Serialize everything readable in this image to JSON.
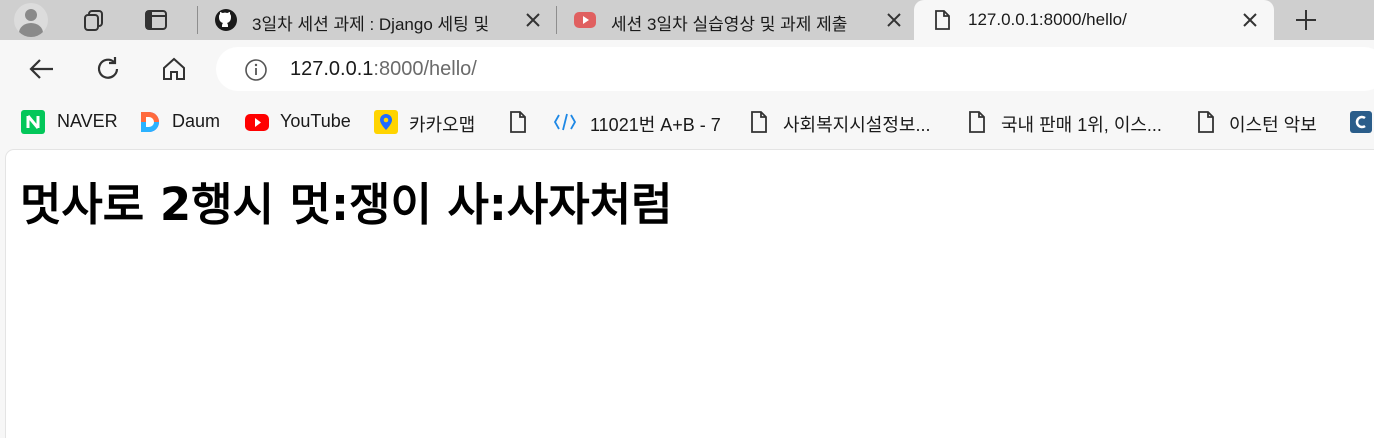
{
  "browser": {
    "tabs": [
      {
        "title": "3일차 세션 과제 : Django 세팅 및 ",
        "icon": "github-icon"
      },
      {
        "title": "세션 3일차 실습영상 및 과제 제출",
        "icon": "youtube-icon"
      },
      {
        "title": "127.0.0.1:8000/hello/",
        "icon": "page-icon",
        "active": true
      }
    ],
    "address_bar": {
      "host": "127.0.0.1",
      "rest": ":8000/hello/"
    },
    "bookmarks": [
      {
        "label": "NAVER",
        "icon": "naver-icon"
      },
      {
        "label": "Daum",
        "icon": "daum-icon"
      },
      {
        "label": "YouTube",
        "icon": "youtube-icon"
      },
      {
        "label": "카카오맵",
        "icon": "kakaomap-icon"
      },
      {
        "label": "",
        "icon": "page-icon"
      },
      {
        "label": "11021번 A+B - 7",
        "icon": "code-icon"
      },
      {
        "label": "사회복지시설정보...",
        "icon": "page-icon"
      },
      {
        "label": "국내 판매 1위, 이스...",
        "icon": "page-icon"
      },
      {
        "label": "이스턴 악보",
        "icon": "page-icon"
      },
      {
        "label": "",
        "icon": "c-app-icon"
      }
    ]
  },
  "page": {
    "heading": "멋사로 2행시 멋:쟁이 사:사자처럼"
  },
  "colors": {
    "tabstrip": "#cfcfcf",
    "toolbar": "#f7f7f7",
    "naver_green": "#03c75a",
    "youtube_red": "#ff0000",
    "kakaomap_yellow": "#ffd400",
    "code_blue": "#1e88e5"
  }
}
